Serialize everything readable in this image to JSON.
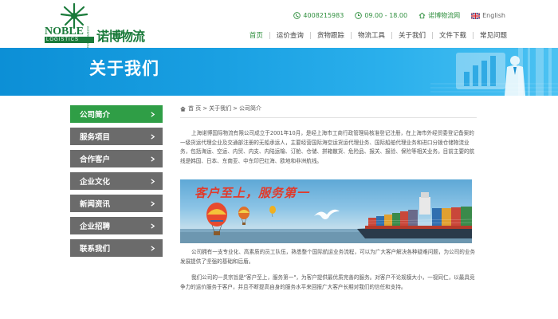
{
  "brand": {
    "name_en": "NOBLE",
    "name_cn": "诺博物流",
    "sub_en": "LOGISTICS",
    "intl": "INTERNATIONAL"
  },
  "topbar": {
    "phone": "4008215983",
    "hours": "09.00 - 18.00",
    "site": "诺博物流网",
    "lang": "English"
  },
  "nav": {
    "items": [
      "首页",
      "运价查询",
      "货物跟踪",
      "物流工具",
      "关于我们",
      "文件下载",
      "常见问题"
    ],
    "active_index": 0
  },
  "banner": {
    "title": "关于我们"
  },
  "sidebar": {
    "items": [
      "公司简介",
      "服务项目",
      "合作客户",
      "企业文化",
      "新闻资讯",
      "企业招聘",
      "联系我们"
    ],
    "active_index": 0
  },
  "breadcrumb": {
    "home": "首 页",
    "section": "关于我们",
    "current": "公司简介"
  },
  "content": {
    "p1": "上海诺博国际物流有限公司成立于2001年10月，是经上海市工商行政管理局核准登记注册，在上海市外经贸委登记备案的一级货运代理企业及交通部注册的无船承运人，主要经营国际海空运货运代理业务、国际船舶代理业务和进口分拨仓储物流业务，包括海运、空运、内贸、内支、内陆运输、订舱、仓储、拼箱散货、危险品、报关、报验、保险等相关业务。目前主要的航线是韩国、日本、东南亚、中东印巴红海、欧地和非洲航线。",
    "slogan": "客户至上，服务第一",
    "p2": "公司拥有一支专业化、高素质的员工队伍，熟悉整个国际航运业务流程，可以为广大客户解决各种疑难问题，为公司的业务发展提供了坚强的基础和后盾。",
    "p3": "我们公司的一贯宗旨是\"客户至上，服务第一\"，为客户提供最优质完善的服务。对客户不论规模大小，一视同仁，以最具竞争力的运价服务于客户，并且不断提高自身的服务水平来回报广大客户长期对我们的信任和支持。"
  },
  "colors": {
    "green": "#2f9e46",
    "banner_blue": "#1aa0e2",
    "sidebar_gray": "#6b6b6b",
    "slogan_red": "#e23a2a"
  }
}
